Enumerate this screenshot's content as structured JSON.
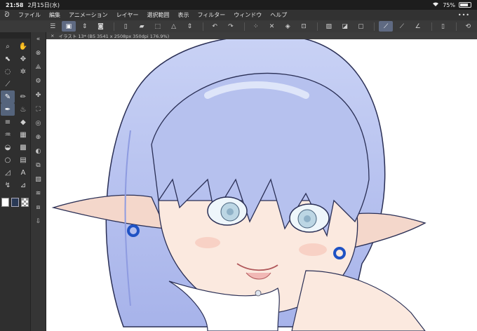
{
  "status": {
    "time": "21:58",
    "date": "2月15日(水)",
    "battery": "75%",
    "battery_level": 0.75
  },
  "menu": {
    "items": [
      "ファイル",
      "編集",
      "アニメーション",
      "レイヤー",
      "選択範囲",
      "表示",
      "フィルター",
      "ウィンドウ",
      "ヘルプ"
    ],
    "more": "•••"
  },
  "document": {
    "tab_title": "イラスト 13* (B5 3541 x 2508px 350dpi 176.9%)"
  },
  "colors": {
    "foreground": "#2a3a56",
    "hair": "#b9c4ef",
    "skin": "#fbe7dc"
  }
}
